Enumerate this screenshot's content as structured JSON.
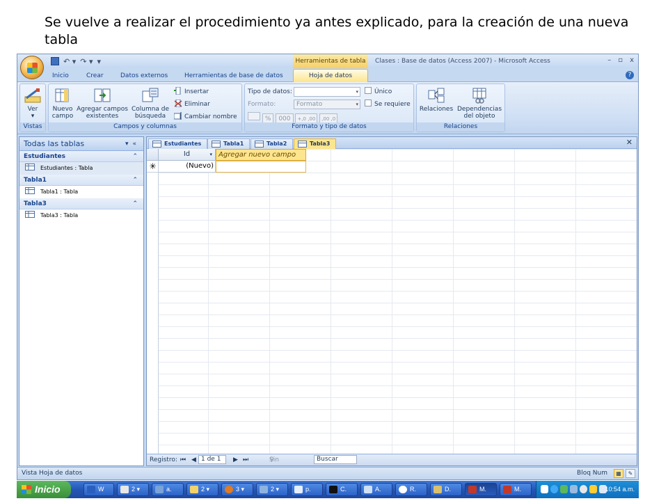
{
  "caption": "Se vuelve a realizar el procedimiento ya antes explicado, para la creación de una nueva tabla",
  "window": {
    "context_tab_header": "Herramientas de tabla",
    "title": "Clases : Base de datos (Access 2007) - Microsoft Access",
    "minimize": "–",
    "restore": "▫",
    "close": "x"
  },
  "ribbon_tabs": [
    "Inicio",
    "Crear",
    "Datos externos",
    "Herramientas de base de datos",
    "Hoja de datos"
  ],
  "ribbon": {
    "vistas": {
      "label": "Vistas",
      "ver": "Ver"
    },
    "campos": {
      "label": "Campos y columnas",
      "nuevo_campo_l1": "Nuevo",
      "nuevo_campo_l2": "campo",
      "agregar_l1": "Agregar campos",
      "agregar_l2": "existentes",
      "columna_l1": "Columna de",
      "columna_l2": "búsqueda",
      "insertar": "Insertar",
      "eliminar": "Eliminar",
      "cambiar_nombre": "Cambiar nombre"
    },
    "formato": {
      "label": "Formato y tipo de datos",
      "tipo_label": "Tipo de datos:",
      "tipo_value": "",
      "formato_label": "Formato:",
      "formato_value": "Formato",
      "unico": "Único",
      "se_requiere": "Se requiere",
      "percent": "%",
      "thousands": "000",
      "dec_more": "+,0 ,00",
      "dec_less": ",00 ,0"
    },
    "relaciones": {
      "label": "Relaciones",
      "relaciones_btn": "Relaciones",
      "dep_l1": "Dependencias",
      "dep_l2": "del objeto"
    }
  },
  "nav_pane": {
    "header": "Todas las tablas",
    "groups": [
      {
        "name": "Estudiantes",
        "items": [
          "Estudiantes : Tabla"
        ]
      },
      {
        "name": "Tabla1",
        "items": [
          "Tabla1 : Tabla"
        ]
      },
      {
        "name": "Tabla3",
        "items": [
          "Tabla3 : Tabla"
        ]
      }
    ]
  },
  "doc_tabs": [
    "Estudiantes",
    "Tabla1",
    "Tabla2",
    "Tabla3"
  ],
  "active_doc_tab": "Tabla3",
  "datasheet": {
    "col_id": "Id",
    "col_add": "Agregar nuevo campo",
    "new_row_marker": "✳",
    "new_row_value": "(Nuevo)"
  },
  "record_nav": {
    "label": "Registro:",
    "first": "⏮",
    "prev": "◀",
    "position": "1 de 1",
    "next": "▶",
    "last": "⏭",
    "filter": "Sin filtro",
    "search": "Buscar"
  },
  "statusbar": {
    "left": "Vista Hoja de datos",
    "right": "Bloq Num"
  },
  "taskbar": {
    "start": "Inicio",
    "buttons": [
      "W",
      "2",
      "a.",
      "2",
      "3",
      "2",
      "p.",
      "C.",
      "A.",
      "R.",
      "D.",
      "M.",
      "M."
    ],
    "clock": "10:54 a.m."
  },
  "colors": {
    "ribbon_blue": "#c5d9f1",
    "active_tab_yellow": "#fde58d",
    "taskbar_blue": "#2456b5",
    "start_green": "#3a8f3a"
  }
}
